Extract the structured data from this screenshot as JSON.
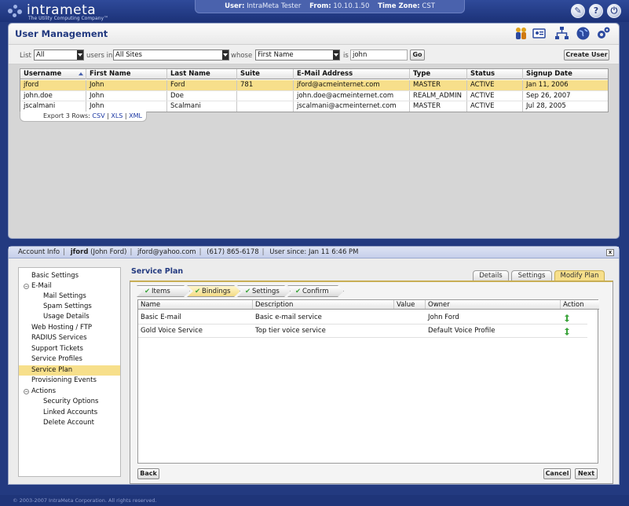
{
  "header": {
    "logo_text": "intrameta",
    "logo_tagline": "The Utility Computing Company™",
    "session": {
      "user_label": "User:",
      "user_value": "IntraMeta Tester",
      "from_label": "From:",
      "from_value": "10.10.1.50",
      "tz_label": "Time Zone:",
      "tz_value": "CST"
    },
    "icons": [
      "tools-icon",
      "help-icon",
      "power-icon"
    ],
    "icon_glyphs": [
      "✎",
      "?",
      "⏻"
    ]
  },
  "user_management": {
    "title": "User Management",
    "toolbar_icons": [
      "users-icon",
      "user-card-icon",
      "network-icon",
      "globe-icon",
      "gears-icon"
    ],
    "filter": {
      "list_label": "List",
      "list_value": "All",
      "users_in_label": "users in",
      "site_value": "All Sites",
      "whose_label": "whose",
      "field_value": "First Name",
      "is_label": "is",
      "search_value": "john",
      "go_label": "Go",
      "create_label": "Create User"
    },
    "columns": [
      "Username",
      "First Name",
      "Last Name",
      "Suite",
      "E-Mail Address",
      "Type",
      "Status",
      "Signup Date"
    ],
    "rows": [
      [
        "jford",
        "John",
        "Ford",
        "781",
        "jford@acmeinternet.com",
        "MASTER",
        "ACTIVE",
        "Jan 11, 2006"
      ],
      [
        "john.doe",
        "John",
        "Doe",
        "",
        "john.doe@acmeinternet.com",
        "REALM_ADMIN",
        "ACTIVE",
        "Sep 26, 2007"
      ],
      [
        "jscalmani",
        "John",
        "Scalmani",
        "",
        "jscalmani@acmeinternet.com",
        "MASTER",
        "ACTIVE",
        "Jul 28, 2005"
      ]
    ],
    "selected_row": 0,
    "export": {
      "label": "Export 3 Rows:",
      "csv": "CSV",
      "xls": "XLS",
      "xml": "XML",
      "sep": "|"
    }
  },
  "account": {
    "bar": {
      "account_info": "Account Info",
      "username": "jford",
      "full_name": "(John Ford)",
      "email": "jford@yahoo.com",
      "phone": "(617) 865-6178",
      "since": "User since: Jan 11 6:46 PM",
      "sep": "|",
      "close": "x"
    },
    "nav": [
      {
        "label": "Basic Settings",
        "level": 0
      },
      {
        "label": "E-Mail",
        "level": 0,
        "toggle": "−"
      },
      {
        "label": "Mail Settings",
        "level": 1
      },
      {
        "label": "Spam Settings",
        "level": 1
      },
      {
        "label": "Usage Details",
        "level": 1
      },
      {
        "label": "Web Hosting / FTP",
        "level": 0
      },
      {
        "label": "RADIUS Services",
        "level": 0
      },
      {
        "label": "Support Tickets",
        "level": 0
      },
      {
        "label": "Service Profiles",
        "level": 0
      },
      {
        "label": "Service Plan",
        "level": 0,
        "selected": true
      },
      {
        "label": "Provisioning Events",
        "level": 0
      },
      {
        "label": "Actions",
        "level": 0,
        "toggle": "−"
      },
      {
        "label": "Security Options",
        "level": 1
      },
      {
        "label": "Linked Accounts",
        "level": 1
      },
      {
        "label": "Delete Account",
        "level": 1
      }
    ],
    "service_plan": {
      "title": "Service Plan",
      "tabs": [
        "Details",
        "Settings",
        "Modify Plan"
      ],
      "active_tab": 2,
      "steps": [
        "Items",
        "Bindings",
        "Settings",
        "Confirm"
      ],
      "current_step": 1,
      "check_glyph": "✔",
      "columns": [
        "Name",
        "Description",
        "Value",
        "Owner",
        "Action"
      ],
      "rows": [
        [
          "Basic E-mail",
          "Basic e-mail service",
          "",
          "John Ford"
        ],
        [
          "Gold Voice Service",
          "Top tier voice service",
          "",
          "Default Voice Profile"
        ]
      ],
      "back_label": "Back",
      "cancel_label": "Cancel",
      "next_label": "Next"
    }
  },
  "footer": {
    "copyright": "© 2003-2007 IntraMeta Corporation.  All rights reserved."
  },
  "colors": {
    "navy": "#233a80",
    "highlight": "#f7df8b",
    "link": "#1b37a3"
  }
}
